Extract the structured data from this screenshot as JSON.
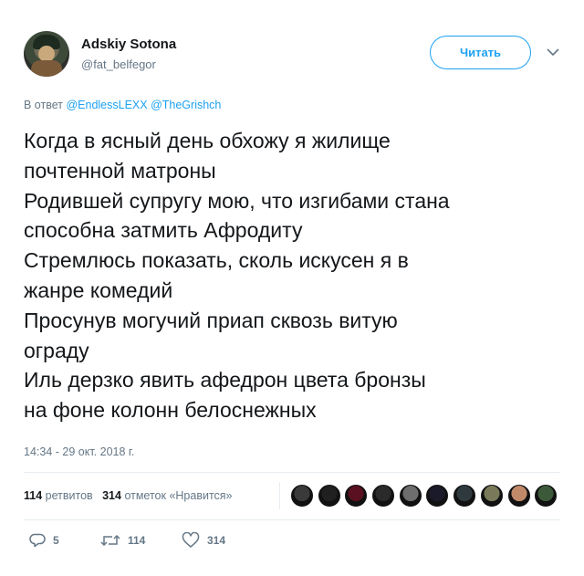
{
  "user": {
    "name": "Adskiy Sotona",
    "handle": "@fat_belfegor"
  },
  "follow_label": "Читать",
  "reply": {
    "prefix": "В ответ",
    "mentions": [
      "@EndlessLEXX",
      "@TheGrishch"
    ]
  },
  "tweet_lines": [
    "Когда в ясный день обхожу я жилище",
    "почтенной матроны",
    "Родившей супругу мою, что изгибами стана",
    "способна затмить Афродиту",
    "Стремлюсь показать, сколь искусен я в",
    "жанре комедий",
    "Просунув могучий приап сквозь витую",
    "ограду",
    "Иль дерзко явить афедрон цвета бронзы",
    "на фоне колонн белоснежных"
  ],
  "timestamp": "14:34 - 29 окт. 2018 г.",
  "stats": {
    "retweets_count": "114",
    "retweets_label": "ретвитов",
    "likes_count": "314",
    "likes_label": "отметок «Нравится»"
  },
  "likers_colors": [
    "#3a3a3a",
    "#202020",
    "#5a1020",
    "#2a2a2a",
    "#6e6e6e",
    "#1a1a2a",
    "#2f3a3f",
    "#7a7a5a",
    "#c08a6a",
    "#3c5a3a"
  ],
  "actions": {
    "reply_count": "5",
    "retweet_count": "114",
    "like_count": "314"
  },
  "colors": {
    "accent": "#1da1f2",
    "muted": "#657786",
    "text": "#14171a"
  }
}
